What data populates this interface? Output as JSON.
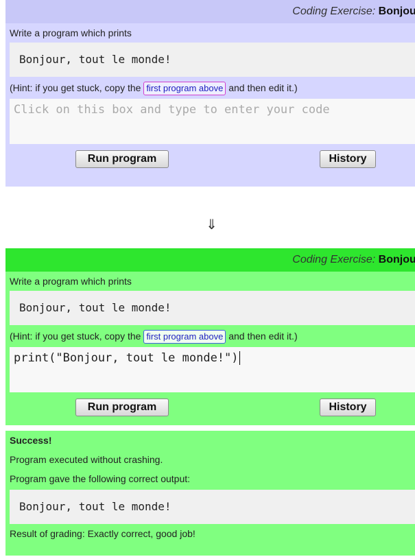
{
  "before": {
    "title_italic": "Coding Exercise:",
    "title_bold": "Bonjour",
    "instruction": "Write a program which prints",
    "expected_output": "Bonjour, tout le monde!",
    "hint_prefix": "(Hint: if you get stuck, copy the",
    "hint_link": "first program above",
    "hint_suffix": "and then edit it.)",
    "editor_placeholder": "Click on this box and type to enter your code",
    "run_label": "Run program",
    "history_label": "History"
  },
  "arrow": "⇓",
  "after": {
    "title_italic": "Coding Exercise:",
    "title_bold": "Bonjour",
    "instruction": "Write a program which prints",
    "expected_output": "Bonjour, tout le monde!",
    "hint_prefix": "(Hint: if you get stuck, copy the",
    "hint_link": "first program above",
    "hint_suffix": "and then edit it.)",
    "editor_value": "print(\"Bonjour, tout le monde!\")",
    "run_label": "Run program",
    "history_label": "History",
    "result": {
      "status": "Success!",
      "line1": "Program executed without crashing.",
      "line2": "Program gave the following correct output:",
      "output": "Bonjour, tout le monde!",
      "grading": "Result of grading: Exactly correct, good job!"
    }
  },
  "colors": {
    "before_panel": "#d6d6ff",
    "before_title": "#c8c8f8",
    "after_panel": "#80ff80",
    "after_title": "#2ee62e"
  }
}
